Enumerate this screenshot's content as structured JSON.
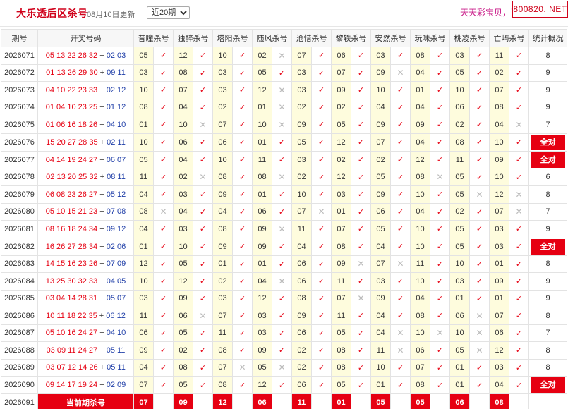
{
  "header": {
    "title": "大乐透后区杀号",
    "updated": "08月10日更新",
    "period_selected": "近20期",
    "slogan": "天天彩宝贝，更",
    "site": "800820. NET"
  },
  "table": {
    "issue_header": "期号",
    "draw_header": "开奖号码",
    "experts": [
      "昔瞳杀号",
      "独醉杀号",
      "塔阳杀号",
      "随风杀号",
      "沧惜杀号",
      "黎轶杀号",
      "安然杀号",
      "玩味杀号",
      "桃凌杀号",
      "亡屿杀号"
    ],
    "stat_header": "统计概况",
    "all_right_label": "全对",
    "rows": [
      {
        "issue": "2026071",
        "front": "05 13 22 26 32",
        "back": "02 03",
        "kills": [
          "05",
          "12",
          "10",
          "02",
          "07",
          "06",
          "03",
          "08",
          "03",
          "11"
        ],
        "marks": [
          1,
          1,
          1,
          0,
          1,
          1,
          1,
          1,
          1,
          1
        ],
        "stat": "8"
      },
      {
        "issue": "2026072",
        "front": "01 13 26 29 30",
        "back": "09 11",
        "kills": [
          "03",
          "08",
          "03",
          "05",
          "03",
          "07",
          "09",
          "04",
          "05",
          "02"
        ],
        "marks": [
          1,
          1,
          1,
          1,
          1,
          1,
          0,
          1,
          1,
          1
        ],
        "stat": "9"
      },
      {
        "issue": "2026073",
        "front": "04 10 22 23 33",
        "back": "02 12",
        "kills": [
          "10",
          "07",
          "03",
          "12",
          "03",
          "09",
          "10",
          "01",
          "10",
          "07"
        ],
        "marks": [
          1,
          1,
          1,
          0,
          1,
          1,
          1,
          1,
          1,
          1
        ],
        "stat": "9"
      },
      {
        "issue": "2026074",
        "front": "01 04 10 23 25",
        "back": "01 12",
        "kills": [
          "08",
          "04",
          "02",
          "01",
          "02",
          "02",
          "04",
          "04",
          "06",
          "08"
        ],
        "marks": [
          1,
          1,
          1,
          0,
          1,
          1,
          1,
          1,
          1,
          1
        ],
        "stat": "9"
      },
      {
        "issue": "2026075",
        "front": "01 06 16 18 26",
        "back": "04 10",
        "kills": [
          "01",
          "10",
          "07",
          "10",
          "09",
          "05",
          "09",
          "09",
          "02",
          "04"
        ],
        "marks": [
          1,
          0,
          1,
          0,
          1,
          1,
          1,
          1,
          1,
          0
        ],
        "stat": "7"
      },
      {
        "issue": "2026076",
        "front": "15 20 27 28 35",
        "back": "02 11",
        "kills": [
          "10",
          "06",
          "06",
          "01",
          "05",
          "12",
          "07",
          "04",
          "08",
          "10"
        ],
        "marks": [
          1,
          1,
          1,
          1,
          1,
          1,
          1,
          1,
          1,
          1
        ],
        "stat": "all"
      },
      {
        "issue": "2026077",
        "front": "04 14 19 24 27",
        "back": "06 07",
        "kills": [
          "05",
          "04",
          "10",
          "11",
          "03",
          "02",
          "02",
          "12",
          "11",
          "09"
        ],
        "marks": [
          1,
          1,
          1,
          1,
          1,
          1,
          1,
          1,
          1,
          1
        ],
        "stat": "all"
      },
      {
        "issue": "2026078",
        "front": "02 13 20 25 32",
        "back": "08 11",
        "kills": [
          "11",
          "02",
          "08",
          "08",
          "02",
          "12",
          "05",
          "08",
          "05",
          "10"
        ],
        "marks": [
          1,
          0,
          1,
          0,
          1,
          1,
          1,
          0,
          1,
          1
        ],
        "stat": "6"
      },
      {
        "issue": "2026079",
        "front": "06 08 23 26 27",
        "back": "05 12",
        "kills": [
          "04",
          "03",
          "09",
          "01",
          "10",
          "03",
          "09",
          "10",
          "05",
          "12"
        ],
        "marks": [
          1,
          1,
          1,
          1,
          1,
          1,
          1,
          1,
          0,
          0
        ],
        "stat": "8"
      },
      {
        "issue": "2026080",
        "front": "05 10 15 21 23",
        "back": "07 08",
        "kills": [
          "08",
          "04",
          "04",
          "06",
          "07",
          "01",
          "06",
          "04",
          "02",
          "07"
        ],
        "marks": [
          0,
          1,
          1,
          1,
          0,
          1,
          1,
          1,
          1,
          0
        ],
        "stat": "7"
      },
      {
        "issue": "2026081",
        "front": "08 16 18 24 34",
        "back": "09 12",
        "kills": [
          "04",
          "03",
          "08",
          "09",
          "11",
          "07",
          "05",
          "10",
          "05",
          "03"
        ],
        "marks": [
          1,
          1,
          1,
          0,
          1,
          1,
          1,
          1,
          1,
          1
        ],
        "stat": "9"
      },
      {
        "issue": "2026082",
        "front": "16 26 27 28 34",
        "back": "02 06",
        "kills": [
          "01",
          "10",
          "09",
          "09",
          "04",
          "08",
          "04",
          "10",
          "05",
          "03"
        ],
        "marks": [
          1,
          1,
          1,
          1,
          1,
          1,
          1,
          1,
          1,
          1
        ],
        "stat": "all"
      },
      {
        "issue": "2026083",
        "front": "14 15 16 23 26",
        "back": "07 09",
        "kills": [
          "12",
          "05",
          "01",
          "01",
          "06",
          "09",
          "07",
          "11",
          "10",
          "01"
        ],
        "marks": [
          1,
          1,
          1,
          1,
          1,
          0,
          0,
          1,
          1,
          1
        ],
        "stat": "8"
      },
      {
        "issue": "2026084",
        "front": "13 25 30 32 33",
        "back": "04 05",
        "kills": [
          "10",
          "12",
          "02",
          "04",
          "06",
          "11",
          "03",
          "10",
          "03",
          "09"
        ],
        "marks": [
          1,
          1,
          1,
          0,
          1,
          1,
          1,
          1,
          1,
          1
        ],
        "stat": "9"
      },
      {
        "issue": "2026085",
        "front": "03 04 14 28 31",
        "back": "05 07",
        "kills": [
          "03",
          "09",
          "03",
          "12",
          "08",
          "07",
          "09",
          "04",
          "01",
          "01"
        ],
        "marks": [
          1,
          1,
          1,
          1,
          1,
          0,
          1,
          1,
          1,
          1
        ],
        "stat": "9"
      },
      {
        "issue": "2026086",
        "front": "10 11 18 22 35",
        "back": "06 12",
        "kills": [
          "11",
          "06",
          "07",
          "03",
          "09",
          "11",
          "04",
          "08",
          "06",
          "07"
        ],
        "marks": [
          1,
          0,
          1,
          1,
          1,
          1,
          1,
          1,
          0,
          1
        ],
        "stat": "8"
      },
      {
        "issue": "2026087",
        "front": "05 10 16 24 27",
        "back": "04 10",
        "kills": [
          "06",
          "05",
          "11",
          "03",
          "06",
          "05",
          "04",
          "10",
          "10",
          "06"
        ],
        "marks": [
          1,
          1,
          1,
          1,
          1,
          1,
          0,
          0,
          0,
          1
        ],
        "stat": "7"
      },
      {
        "issue": "2026088",
        "front": "03 09 11 24 27",
        "back": "05 11",
        "kills": [
          "09",
          "02",
          "08",
          "09",
          "02",
          "08",
          "11",
          "06",
          "05",
          "12"
        ],
        "marks": [
          1,
          1,
          1,
          1,
          1,
          1,
          0,
          1,
          0,
          1
        ],
        "stat": "8"
      },
      {
        "issue": "2026089",
        "front": "03 07 12 14 26",
        "back": "05 11",
        "kills": [
          "04",
          "08",
          "07",
          "05",
          "02",
          "08",
          "10",
          "07",
          "01",
          "03"
        ],
        "marks": [
          1,
          1,
          0,
          0,
          1,
          1,
          1,
          1,
          1,
          1
        ],
        "stat": "8"
      },
      {
        "issue": "2026090",
        "front": "09 14 17 19 24",
        "back": "02 09",
        "kills": [
          "07",
          "05",
          "08",
          "12",
          "06",
          "05",
          "01",
          "08",
          "01",
          "04"
        ],
        "marks": [
          1,
          1,
          1,
          1,
          1,
          1,
          1,
          1,
          1,
          1
        ],
        "stat": "all"
      }
    ],
    "current": {
      "issue": "2026091",
      "label": "当前期杀号",
      "kills": [
        "07",
        "09",
        "12",
        "06",
        "11",
        "01",
        "05",
        "05",
        "06",
        "08"
      ]
    }
  },
  "colors": {
    "red": "#e60012",
    "blue": "#1f3ea8",
    "kill_bg": "#fefcdd",
    "title": "#d0021b",
    "slogan": "#c71585"
  },
  "icons": {
    "correct": "check-icon",
    "wrong": "cross-icon"
  }
}
